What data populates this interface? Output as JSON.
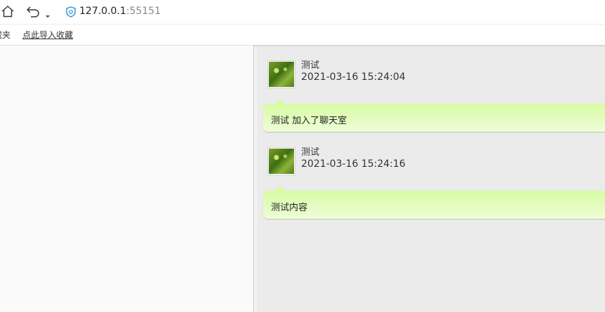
{
  "browser": {
    "url_host": "127.0.0.1",
    "url_port": ":55151",
    "bookmarks": {
      "folder_label": "藏夹",
      "import_label": "点此导入收藏"
    }
  },
  "chat": {
    "messages": [
      {
        "user": "测试",
        "time": "2021-03-16 15:24:04",
        "text": "测试 加入了聊天室"
      },
      {
        "user": "测试",
        "time": "2021-03-16 15:24:16",
        "text": "测试内容"
      }
    ]
  }
}
